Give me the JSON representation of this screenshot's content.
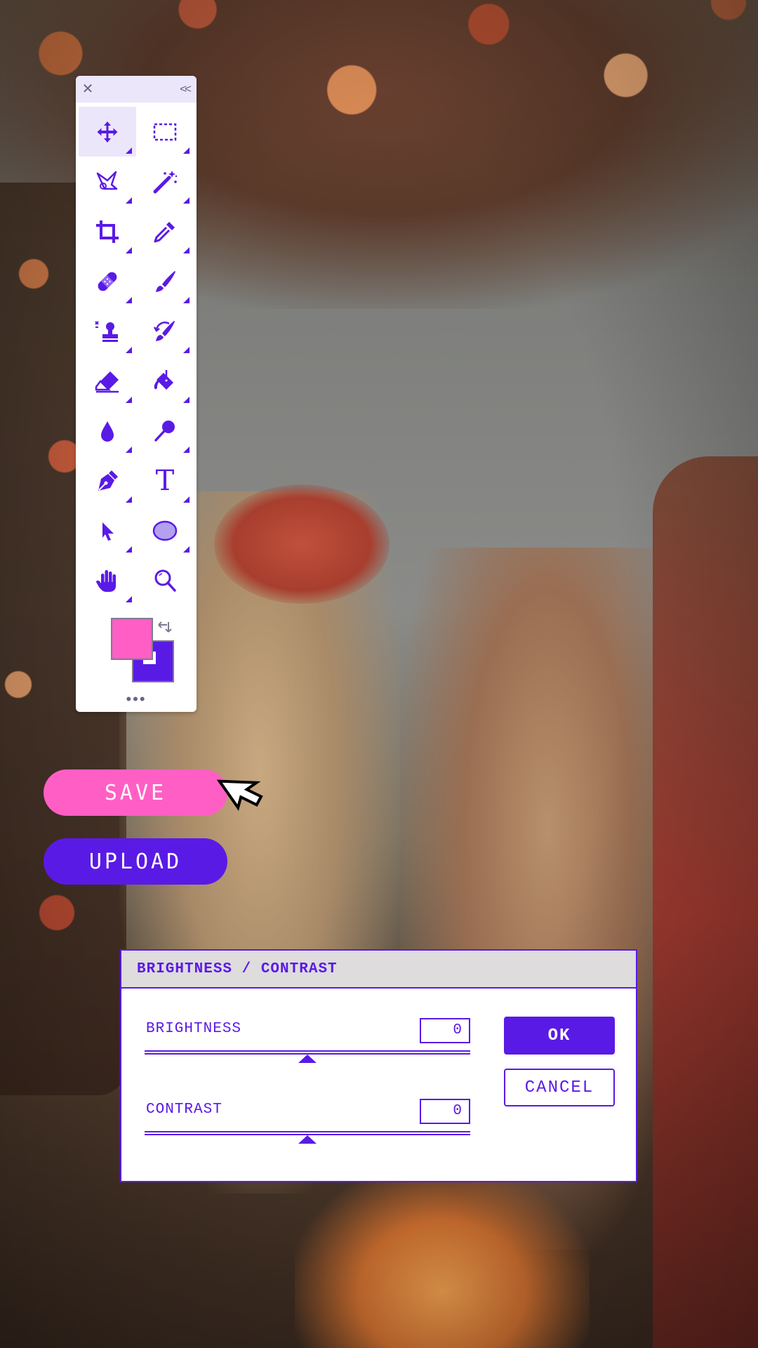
{
  "colors": {
    "accent": "#5a1ae6",
    "pink": "#ff5fc4",
    "panel_header": "#ece6fb",
    "dialog_title_bg": "#dedcdd"
  },
  "photo": {
    "subject": "wedding-couple-photo"
  },
  "tools_panel": {
    "header_icons": [
      "close-icon",
      "collapse-icon"
    ],
    "tools": [
      {
        "name": "move-tool",
        "icon": "move-icon",
        "active": true
      },
      {
        "name": "marquee-tool",
        "icon": "marquee-icon",
        "active": false
      },
      {
        "name": "lasso-tool",
        "icon": "lasso-icon",
        "active": false
      },
      {
        "name": "magic-wand-tool",
        "icon": "magic-wand-icon",
        "active": false
      },
      {
        "name": "crop-tool",
        "icon": "crop-icon",
        "active": false
      },
      {
        "name": "eyedropper-tool",
        "icon": "eyedropper-icon",
        "active": false
      },
      {
        "name": "healing-tool",
        "icon": "bandage-icon",
        "active": false
      },
      {
        "name": "brush-tool",
        "icon": "brush-icon",
        "active": false
      },
      {
        "name": "clone-stamp-tool",
        "icon": "stamp-icon",
        "active": false
      },
      {
        "name": "history-brush-tool",
        "icon": "history-brush-icon",
        "active": false
      },
      {
        "name": "eraser-tool",
        "icon": "eraser-icon",
        "active": false
      },
      {
        "name": "paint-bucket-tool",
        "icon": "paint-bucket-icon",
        "active": false
      },
      {
        "name": "blur-tool",
        "icon": "drop-icon",
        "active": false
      },
      {
        "name": "dodge-tool",
        "icon": "dodge-icon",
        "active": false
      },
      {
        "name": "pen-tool",
        "icon": "pen-nib-icon",
        "active": false
      },
      {
        "name": "text-tool",
        "icon": "text-icon",
        "active": false
      },
      {
        "name": "path-select-tool",
        "icon": "arrow-pointer-icon",
        "active": false
      },
      {
        "name": "ellipse-tool",
        "icon": "ellipse-icon",
        "active": false
      },
      {
        "name": "hand-tool",
        "icon": "hand-icon",
        "active": false
      },
      {
        "name": "zoom-tool",
        "icon": "magnifier-icon",
        "active": false
      }
    ],
    "foreground_color": "#ff5fc4",
    "background_color": "#5a1ae6",
    "text_tool_glyph": "T"
  },
  "buttons": {
    "save_label": "SAVE",
    "upload_label": "UPLOAD"
  },
  "dialog": {
    "title": "BRIGHTNESS / CONTRAST",
    "brightness": {
      "label": "BRIGHTNESS",
      "value": "0",
      "slider_position": 0.5
    },
    "contrast": {
      "label": "CONTRAST",
      "value": "0",
      "slider_position": 0.5
    },
    "ok_label": "OK",
    "cancel_label": "CANCEL"
  }
}
